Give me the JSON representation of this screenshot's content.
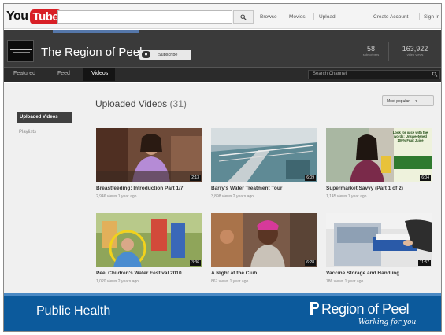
{
  "youtube": {
    "logo_you": "You",
    "logo_tube": "Tube",
    "search_placeholder": "",
    "nav_links": [
      "Browse",
      "Movies",
      "Upload"
    ],
    "account_links": [
      "Create Account",
      "Sign In"
    ]
  },
  "channel": {
    "title": "The Region of Peel",
    "subscribe_label": "Subscribe",
    "stats": [
      {
        "value": "58",
        "label": "subscribers"
      },
      {
        "value": "163,922",
        "label": "video views"
      }
    ],
    "tabs": [
      "Featured",
      "Feed",
      "Videos"
    ],
    "active_tab": "Videos",
    "search_label": "Search Channel"
  },
  "sidebar": {
    "uploaded_label": "Uploaded Videos",
    "playlists_label": "Playlists"
  },
  "uploads": {
    "title": "Uploaded Videos",
    "count": "(31)",
    "sort_label": "Most popular"
  },
  "videos": [
    {
      "title": "Breastfeeding: Introduction Part 1/7",
      "meta": "2,946 views  1 year ago",
      "duration": "2:13"
    },
    {
      "title": "Barry's Water Treatment Tour",
      "meta": "3,898 views  2 years ago",
      "duration": "6:09"
    },
    {
      "title": "Supermarket Savvy (Part 1 of 2)",
      "meta": "1,145 views  1 year ago",
      "duration": "6:04",
      "thumb_text": "Look for juice with the words: Unsweetened 100% Fruit Juice"
    },
    {
      "title": "Peel Children's Water Festival 2010",
      "meta": "1,020 views  2 years ago",
      "duration": "3:36"
    },
    {
      "title": "A Night at the Club",
      "meta": "867 views  1 year ago",
      "duration": "6:28"
    },
    {
      "title": "Vaccine Storage and Handling",
      "meta": "786 views  1 year ago",
      "duration": "11:57"
    }
  ],
  "footer": {
    "department": "Public Health",
    "org_name": "Region of Peel",
    "tagline": "Working for you"
  },
  "colors": {
    "footer_blue": "#0c5a9c",
    "youtube_red": "#d81f26",
    "channel_dark": "#3a3a3a"
  }
}
